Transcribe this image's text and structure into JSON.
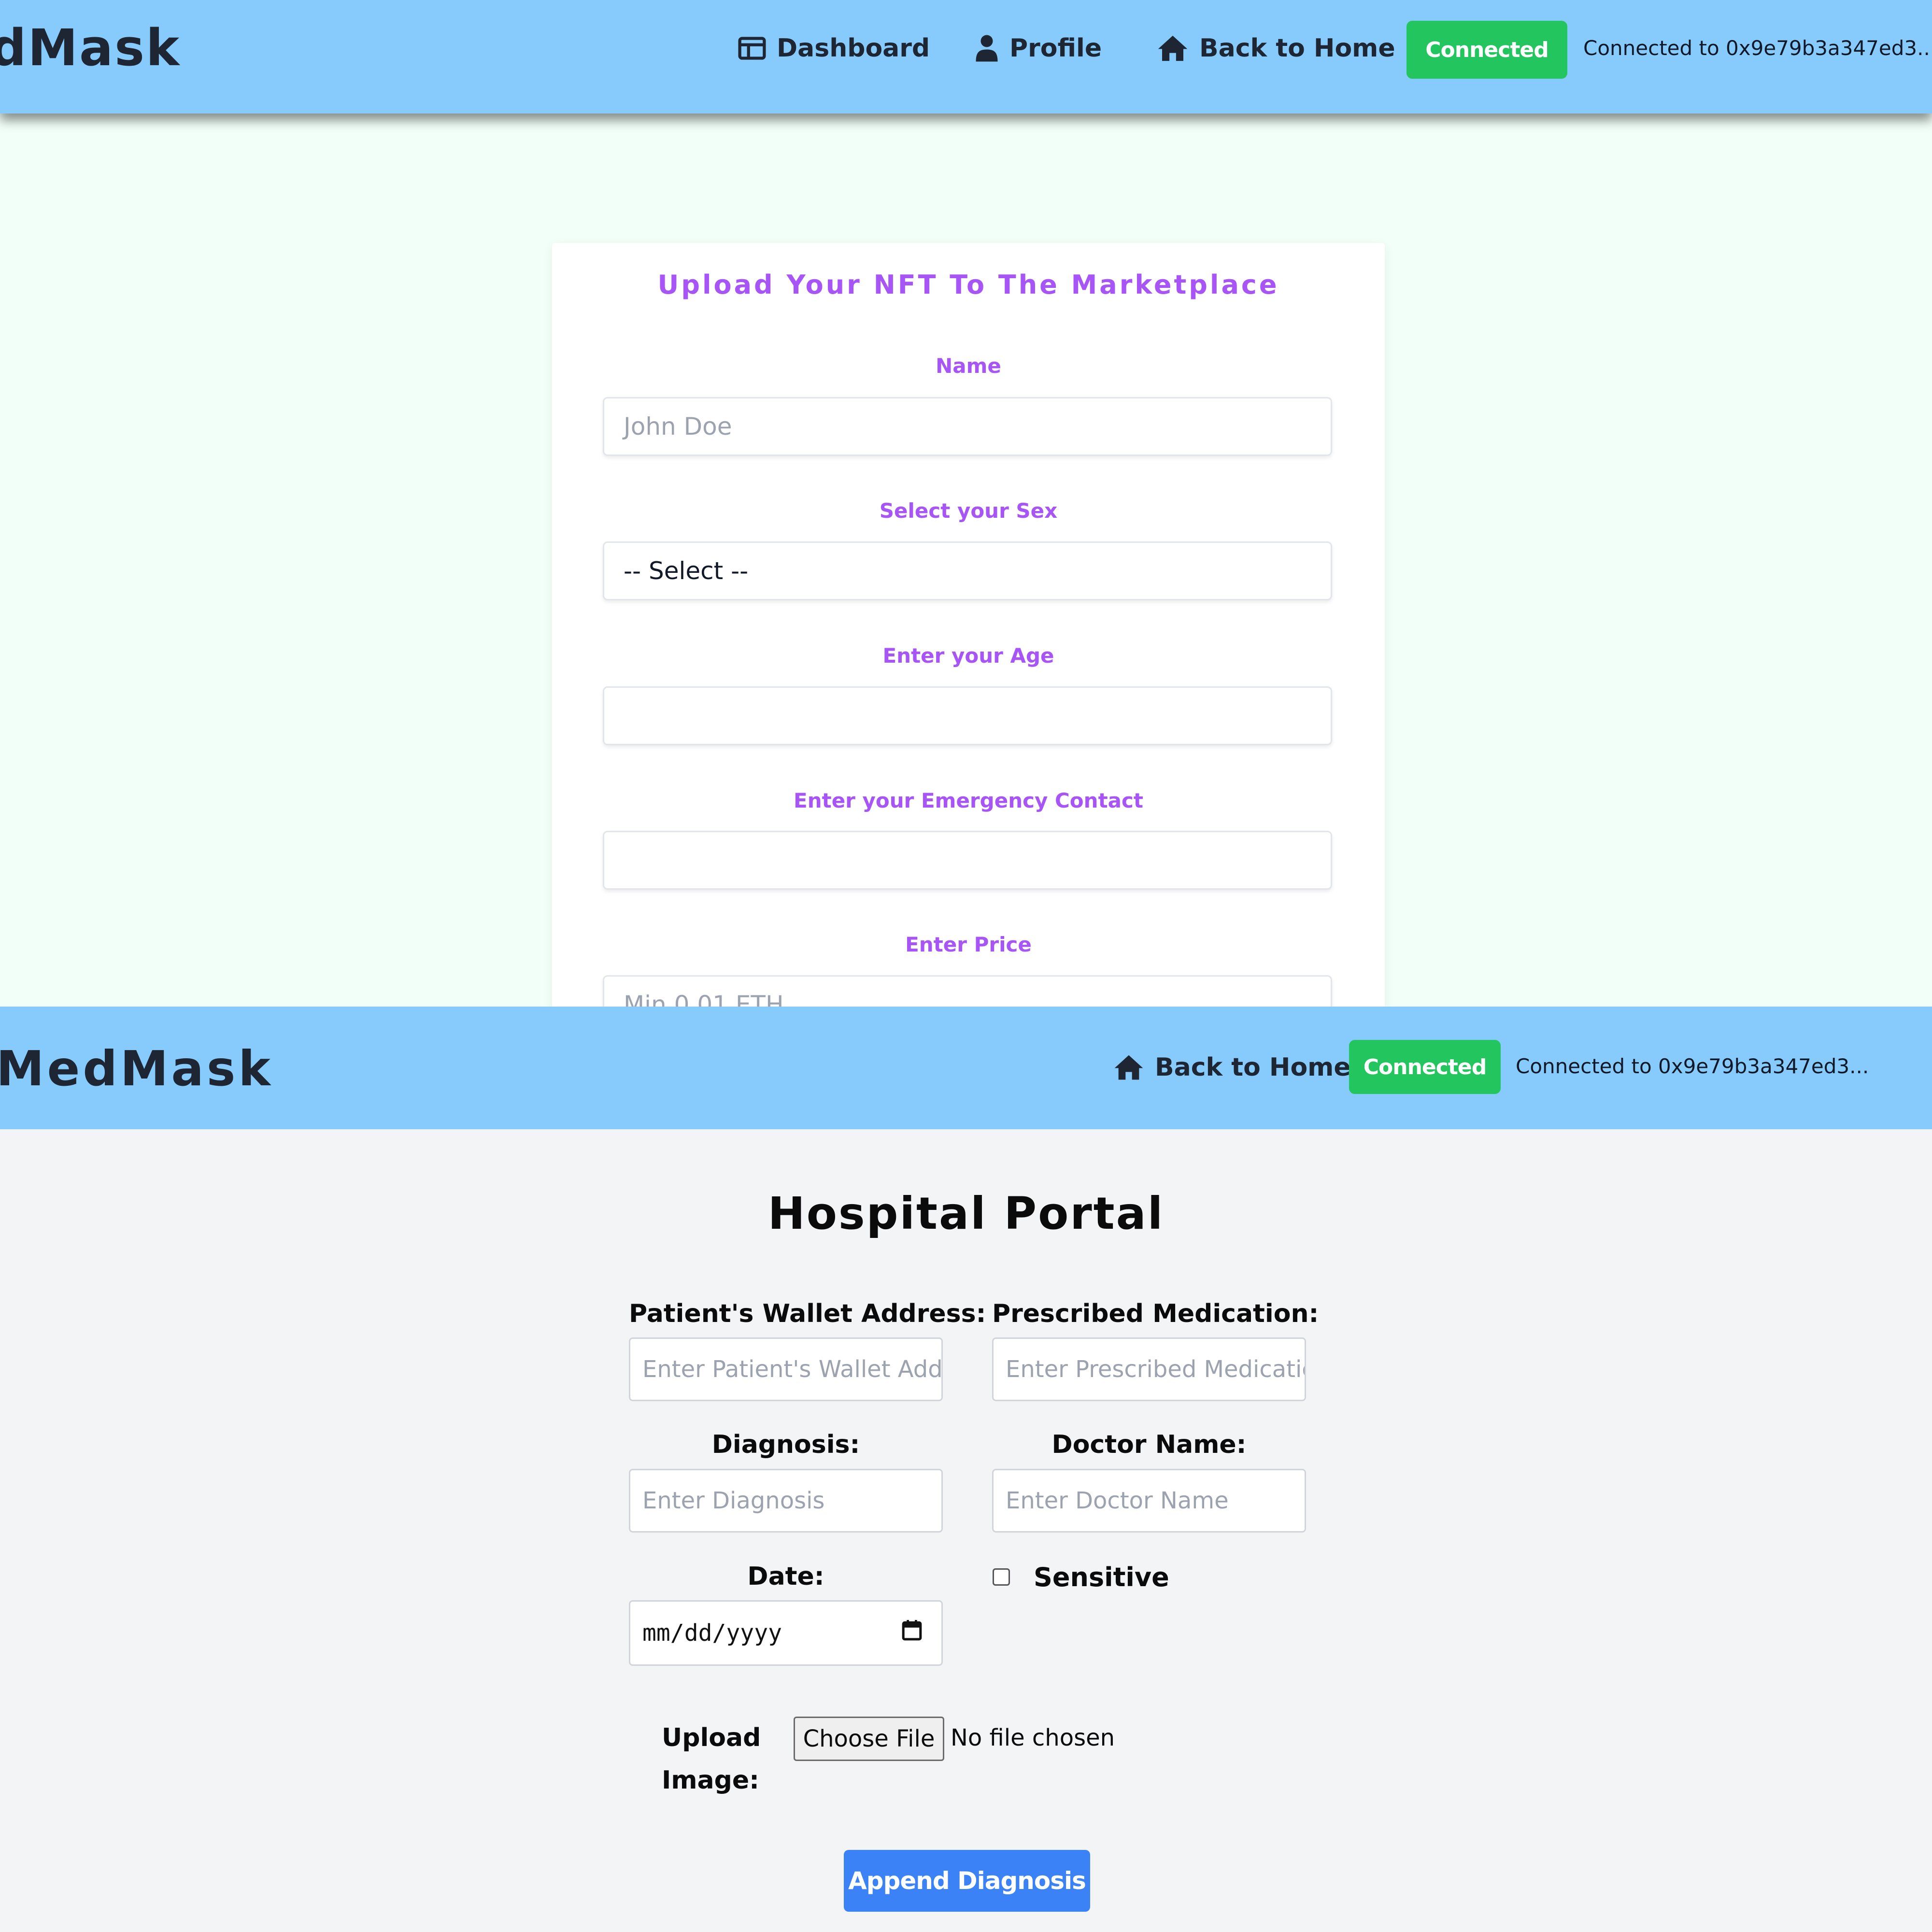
{
  "top_view": {
    "brand": "dMask",
    "nav": {
      "dashboard": "Dashboard",
      "profile": "Profile",
      "back_home": "Back to Home",
      "connected": "Connected",
      "connected_to": "Connected to 0x9e79b3a347ed3..."
    },
    "form": {
      "title": "Upload Your NFT To The Marketplace",
      "name_label": "Name",
      "name_placeholder": "John Doe",
      "sex_label": "Select your Sex",
      "sex_selected": "-- Select --",
      "age_label": "Enter your Age",
      "contact_label": "Enter your Emergency Contact",
      "price_label": "Enter Price",
      "price_placeholder": "Min 0.01 ETH"
    }
  },
  "bottom_view": {
    "brand": "MedMask",
    "nav": {
      "back_home": "Back to Home",
      "connected": "Connected",
      "connected_to": "Connected to 0x9e79b3a347ed3..."
    },
    "portal": {
      "title": "Hospital Portal",
      "wallet_label": "Patient's Wallet Address:",
      "wallet_placeholder": "Enter Patient's Wallet Addr",
      "medication_label": "Prescribed Medication:",
      "medication_placeholder": "Enter Prescribed Medicatic",
      "diagnosis_label": "Diagnosis:",
      "diagnosis_placeholder": "Enter Diagnosis",
      "doctor_label": "Doctor Name:",
      "doctor_placeholder": "Enter Doctor Name",
      "date_label": "Date:",
      "date_value": "mm/dd/yyyy",
      "sensitive_label": "Sensitive",
      "upload_label_line1": "Upload",
      "upload_label_line2": "Image:",
      "choose_file": "Choose File",
      "no_file": "No file chosen",
      "submit": "Append Diagnosis"
    }
  },
  "colors": {
    "navbar": "#86cbfb",
    "connected": "#22c55e",
    "accent_purple": "#a855f7",
    "button_blue": "#3b82f6"
  }
}
